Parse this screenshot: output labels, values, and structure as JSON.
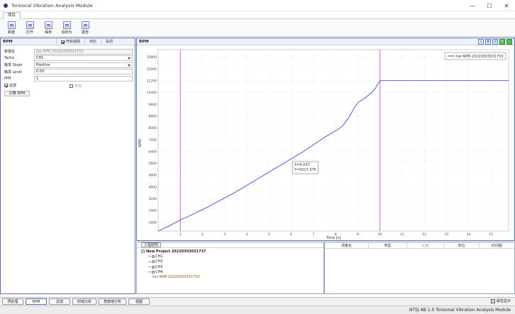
{
  "window": {
    "title": "Torsional Vibration Analysis Module",
    "controls": [
      "—",
      "☐",
      "✕"
    ]
  },
  "ribbon": {
    "tab": "项目",
    "buttons": [
      {
        "label": "新建",
        "icon": "new-file-icon"
      },
      {
        "label": "打开",
        "icon": "open-icon"
      },
      {
        "label": "保存",
        "icon": "save-icon"
      },
      {
        "label": "另存为",
        "icon": "save-as-icon"
      },
      {
        "label": "报告",
        "icon": "report-icon"
      }
    ]
  },
  "left_panel": {
    "title": "RPM",
    "tabs": [
      "开启追踪",
      "对比",
      "关闭"
    ],
    "fields": {
      "name_label": "新建名",
      "name_value": "tex RPM 20220303031753",
      "tacho_label": "Tacho",
      "tacho_value": "CH1",
      "slope_label": "触发 Slope",
      "slope_value": "Positive",
      "level_label": "触发 Level",
      "level_value": "0.00",
      "ppr_label": "PPR",
      "ppr_value": "1"
    },
    "filter_label": "滤波",
    "average_label": "平均",
    "calc_button": "计算 RPM"
  },
  "chart_panel": {
    "title": "RPM",
    "tools": [
      "zoom-icon",
      "move-icon",
      "reset-icon",
      "pen-icon",
      "green-icon"
    ]
  },
  "chart_data": {
    "type": "line",
    "title": "",
    "xlabel": "Time [s]",
    "ylabel": "RPM",
    "xlim": [
      0,
      15.8
    ],
    "ylim": [
      1000,
      13300
    ],
    "x_ticks": [
      "1",
      "2",
      "3",
      "4",
      "5",
      "6",
      "7",
      "8",
      "9",
      "10",
      "11",
      "12",
      "13",
      "14",
      "15"
    ],
    "y_ticks": [
      "1600",
      "2400",
      "3200",
      "4000",
      "4800",
      "5600",
      "6400",
      "7200",
      "8000",
      "8800",
      "9600",
      "10400",
      "11200",
      "12000",
      "12800"
    ],
    "grid": true,
    "legend_position": "top-right",
    "series": [
      {
        "name": "tex RPM 20220303031753",
        "color": "#3b4fd0",
        "x": [
          0.0,
          0.5,
          1.0,
          1.5,
          2.0,
          2.5,
          3.0,
          3.5,
          4.0,
          4.5,
          5.0,
          5.5,
          6.0,
          6.5,
          7.0,
          7.5,
          8.0,
          8.3,
          8.6,
          8.8,
          9.0,
          9.3,
          9.6,
          9.8,
          10.0,
          12.0,
          15.8
        ],
        "y": [
          1000,
          1350,
          1750,
          2100,
          2450,
          2850,
          3250,
          3650,
          4100,
          4550,
          5000,
          5450,
          5900,
          6350,
          6850,
          7350,
          7800,
          8100,
          8700,
          9250,
          9700,
          10000,
          10350,
          10700,
          11200,
          11200,
          11200
        ]
      }
    ],
    "cursor_lines_x": [
      1.0,
      10.0
    ],
    "tooltip": {
      "x_text": "X=6.037",
      "y_text": "Y=5517.375"
    }
  },
  "tree": {
    "header": "工程结构",
    "project": "New Project 20220303031737",
    "channels": [
      "CH1",
      "CH2",
      "CH3",
      "CH4"
    ],
    "rpm_item": "tex RPM 20220303031753"
  },
  "table": {
    "columns": [
      "测量名",
      "类型",
      "长度",
      "单位",
      "时间戳"
    ]
  },
  "bottom_tabs": [
    "预处理",
    "RPM",
    "滤波",
    "时域分析",
    "角度域分析",
    "视图"
  ],
  "bottom_right": "属性显示",
  "status": "NTSJ AB 1.0 Torsional Vibration Analysis Module",
  "colors": {
    "accent": "#5a6fb0",
    "series": "#3b4fd0",
    "cursor": "#d050d0"
  }
}
